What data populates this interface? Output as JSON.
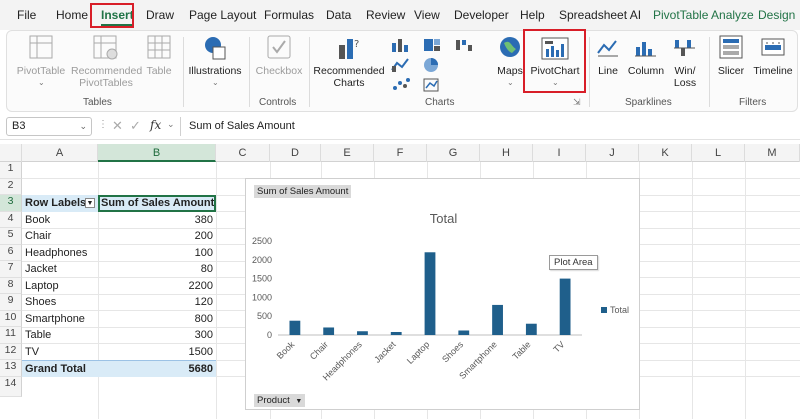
{
  "ribbon_tabs": [
    "File",
    "Home",
    "Insert",
    "Draw",
    "Page Layout",
    "Formulas",
    "Data",
    "Review",
    "View",
    "Developer",
    "Help",
    "Spreadsheet AI",
    "PivotTable Analyze",
    "Design"
  ],
  "tables_group": {
    "label": "Tables",
    "pivottable": "PivotTable",
    "recommended_line1": "Recommended",
    "recommended_line2": "PivotTables",
    "table": "Table"
  },
  "illustrations": {
    "label": "Illustrations"
  },
  "controls_group": {
    "label": "Controls",
    "checkbox": "Checkbox"
  },
  "charts_group": {
    "label": "Charts",
    "recommended_line1": "Recommended",
    "recommended_line2": "Charts",
    "maps": "Maps",
    "pivotchart": "PivotChart"
  },
  "sparklines_group": {
    "label": "Sparklines",
    "line": "Line",
    "column": "Column",
    "winloss_line1": "Win/",
    "winloss_line2": "Loss"
  },
  "filters_group": {
    "label": "Filters",
    "slicer": "Slicer",
    "timeline": "Timeline"
  },
  "formula_bar": {
    "name_box": "B3",
    "fx": "fx",
    "content": "Sum of Sales Amount"
  },
  "columns": [
    "A",
    "B",
    "C",
    "D",
    "E",
    "F",
    "G",
    "H",
    "I",
    "J",
    "K",
    "L",
    "M"
  ],
  "rows": [
    "1",
    "2",
    "3",
    "4",
    "5",
    "6",
    "7",
    "8",
    "9",
    "10",
    "11",
    "12",
    "13",
    "14"
  ],
  "pivot": {
    "header_label": "Row Labels",
    "header_value": "Sum of Sales Amount",
    "items": [
      {
        "label": "Book",
        "value": "380"
      },
      {
        "label": "Chair",
        "value": "200"
      },
      {
        "label": "Headphones",
        "value": "100"
      },
      {
        "label": "Jacket",
        "value": "80"
      },
      {
        "label": "Laptop",
        "value": "2200"
      },
      {
        "label": "Shoes",
        "value": "120"
      },
      {
        "label": "Smartphone",
        "value": "800"
      },
      {
        "label": "Table",
        "value": "300"
      },
      {
        "label": "TV",
        "value": "1500"
      }
    ],
    "total_label": "Grand Total",
    "total_value": "5680"
  },
  "chart_data": {
    "type": "bar",
    "title": "Total",
    "categories": [
      "Book",
      "Chair",
      "Headphones",
      "Jacket",
      "Laptop",
      "Shoes",
      "Smartphone",
      "Table",
      "TV"
    ],
    "series": [
      {
        "name": "Total",
        "values": [
          380,
          200,
          100,
          80,
          2200,
          120,
          800,
          300,
          1500
        ]
      }
    ],
    "ylim": [
      0,
      2500
    ],
    "yticks": [
      0,
      500,
      1000,
      1500,
      2000,
      2500
    ],
    "legend": "right",
    "grid": false,
    "value_field_button": "Sum of Sales Amount",
    "axis_field_button": "Product",
    "tooltip": "Plot Area",
    "color": "#1f5f8b"
  },
  "colors": {
    "accent": "#217346",
    "highlight": "#d81e28",
    "pivot_header": "#d9ebf7"
  }
}
